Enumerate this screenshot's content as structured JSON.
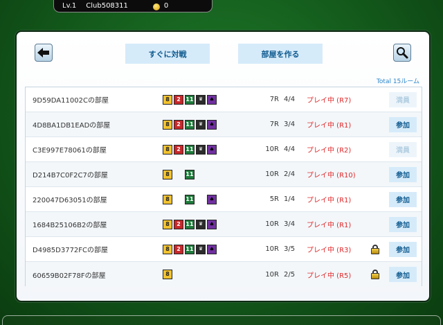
{
  "topbar": {
    "level": "Lv.1",
    "club": "Club508311",
    "coins": "0"
  },
  "toolbar": {
    "quick_match": "すぐに対戦",
    "create_room": "部屋を作る"
  },
  "total": "Total 15ルーム",
  "rooms": [
    {
      "name": "9D59DA11002Cの部屋",
      "badges": [
        "8",
        "2",
        "11",
        "J",
        "S"
      ],
      "rounds": "7R",
      "players": "4/4",
      "status": "プレイ中 (R7)",
      "locked": false,
      "action": "満員",
      "action_type": "full"
    },
    {
      "name": "4D8BA1DB1EADの部屋",
      "badges": [
        "8",
        "2",
        "11",
        "J",
        "S"
      ],
      "rounds": "7R",
      "players": "3/4",
      "status": "プレイ中 (R1)",
      "locked": false,
      "action": "参加",
      "action_type": "join"
    },
    {
      "name": "C3E997E78061の部屋",
      "badges": [
        "8",
        "2",
        "11",
        "J",
        "S"
      ],
      "rounds": "10R",
      "players": "4/4",
      "status": "プレイ中 (R2)",
      "locked": false,
      "action": "満員",
      "action_type": "full"
    },
    {
      "name": "D214B7C0F2C7の部屋",
      "badges": [
        "8",
        "",
        "11",
        "",
        ""
      ],
      "rounds": "10R",
      "players": "2/4",
      "status": "プレイ中 (R10)",
      "locked": false,
      "action": "参加",
      "action_type": "join"
    },
    {
      "name": "220047D63051の部屋",
      "badges": [
        "8",
        "",
        "11",
        "",
        "S"
      ],
      "rounds": "5R",
      "players": "1/4",
      "status": "プレイ中 (R1)",
      "locked": false,
      "action": "参加",
      "action_type": "join"
    },
    {
      "name": "1684B25106B2の部屋",
      "badges": [
        "8",
        "2",
        "11",
        "J",
        "S"
      ],
      "rounds": "10R",
      "players": "3/4",
      "status": "プレイ中 (R1)",
      "locked": false,
      "action": "参加",
      "action_type": "join"
    },
    {
      "name": "D4985D3772FCの部屋",
      "badges": [
        "8",
        "2",
        "11",
        "J",
        "S"
      ],
      "rounds": "10R",
      "players": "3/5",
      "status": "プレイ中 (R3)",
      "locked": true,
      "action": "参加",
      "action_type": "join"
    },
    {
      "name": "60659B02F78Fの部屋",
      "badges": [
        "8",
        "",
        "",
        "",
        ""
      ],
      "rounds": "10R",
      "players": "2/5",
      "status": "プレイ中 (R5)",
      "locked": true,
      "action": "参加",
      "action_type": "join"
    }
  ]
}
